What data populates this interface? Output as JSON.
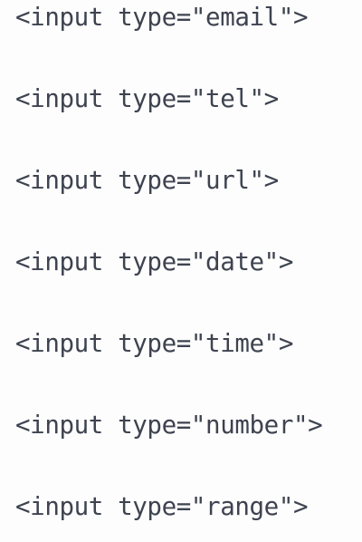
{
  "lines": [
    "<input type=\"email\">",
    "<input type=\"tel\">",
    "<input type=\"url\">",
    "<input type=\"date\">",
    "<input type=\"time\">",
    "<input type=\"number\">",
    "<input type=\"range\">"
  ],
  "colors": {
    "text": "#3e4350",
    "background": "#fdfdfd"
  }
}
